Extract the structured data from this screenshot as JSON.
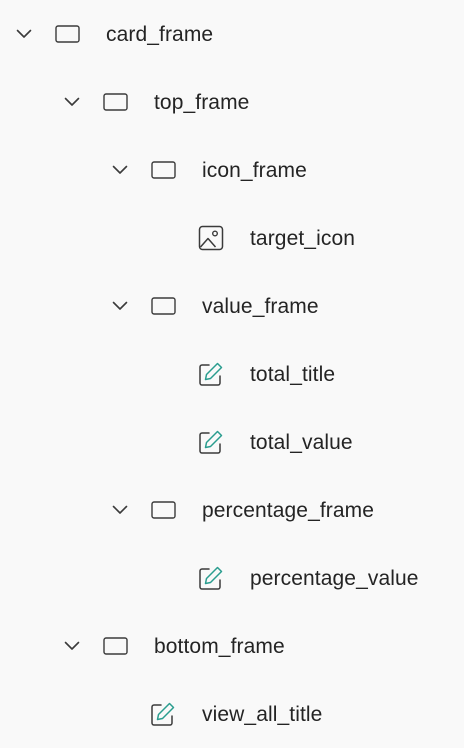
{
  "tree": {
    "card_frame": {
      "label": "card_frame",
      "icon": "frame-icon",
      "expanded": true
    },
    "top_frame": {
      "label": "top_frame",
      "icon": "frame-icon",
      "expanded": true
    },
    "icon_frame": {
      "label": "icon_frame",
      "icon": "frame-icon",
      "expanded": true
    },
    "target_icon": {
      "label": "target_icon",
      "icon": "image-icon"
    },
    "value_frame": {
      "label": "value_frame",
      "icon": "frame-icon",
      "expanded": true
    },
    "total_title": {
      "label": "total_title",
      "icon": "edit-text-icon"
    },
    "total_value": {
      "label": "total_value",
      "icon": "edit-text-icon"
    },
    "percentage_frame": {
      "label": "percentage_frame",
      "icon": "frame-icon",
      "expanded": true
    },
    "percentage_value": {
      "label": "percentage_value",
      "icon": "edit-text-icon"
    },
    "bottom_frame": {
      "label": "bottom_frame",
      "icon": "frame-icon",
      "expanded": true
    },
    "view_all_title": {
      "label": "view_all_title",
      "icon": "edit-text-icon"
    }
  },
  "colors": {
    "background": "#f9f9f9",
    "text": "#242424",
    "icon_stroke": "#3b3b3b",
    "pencil_accent": "#2a9d8f"
  }
}
